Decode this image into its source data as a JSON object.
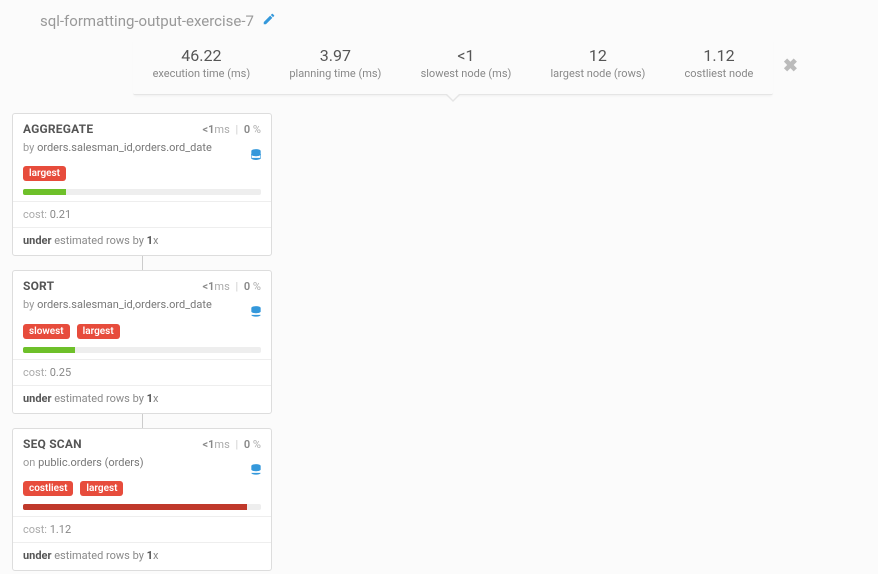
{
  "header": {
    "title": "sql-formatting-output-exercise-7",
    "stats": [
      {
        "value": "46.22",
        "label": "execution time (ms)"
      },
      {
        "value": "3.97",
        "label": "planning time (ms)"
      },
      {
        "value": "<1",
        "label": "slowest node (ms)"
      },
      {
        "value": "12",
        "label": "largest node (rows)"
      },
      {
        "value": "1.12",
        "label": "costliest node"
      }
    ]
  },
  "labels": {
    "cost_prefix": "cost: ",
    "by_prefix": "by ",
    "on_prefix": "on ",
    "ms_suffix": "ms",
    "pct_suffix": " %",
    "sep": "|"
  },
  "nodes": [
    {
      "title": "AGGREGATE",
      "time_num": "<1",
      "pct_num": "0",
      "sub_prefix": "by",
      "sub_value": "orders.salesman_id,orders.ord_date",
      "tags": [
        "largest"
      ],
      "bar_color": "green",
      "bar_width": "18%",
      "cost": "0.21",
      "estimate_lead": "under",
      "estimate_mid": " estimated rows by ",
      "estimate_factor": "1",
      "estimate_tail": "x"
    },
    {
      "title": "SORT",
      "time_num": "<1",
      "pct_num": "0",
      "sub_prefix": "by",
      "sub_value": "orders.salesman_id,orders.ord_date",
      "tags": [
        "slowest",
        "largest"
      ],
      "bar_color": "green",
      "bar_width": "22%",
      "cost": "0.25",
      "estimate_lead": "under",
      "estimate_mid": " estimated rows by ",
      "estimate_factor": "1",
      "estimate_tail": "x"
    },
    {
      "title": "SEQ SCAN",
      "time_num": "<1",
      "pct_num": "0",
      "sub_prefix": "on",
      "sub_value": "public.orders (orders)",
      "tags": [
        "costliest",
        "largest"
      ],
      "bar_color": "red",
      "bar_width": "94%",
      "cost": "1.12",
      "estimate_lead": "under",
      "estimate_mid": " estimated rows by ",
      "estimate_factor": "1",
      "estimate_tail": "x"
    }
  ]
}
